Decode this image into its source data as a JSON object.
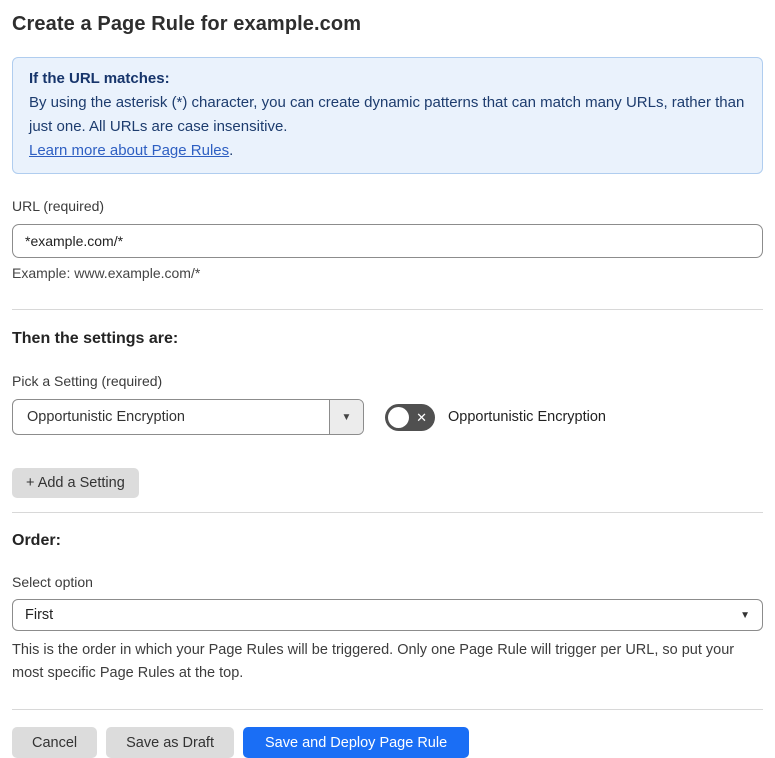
{
  "page": {
    "title": "Create a Page Rule for example.com"
  },
  "callout": {
    "heading": "If the URL matches:",
    "body": "By using the asterisk (*) character, you can create dynamic patterns that can match many URLs, rather than just one. All URLs are case insensitive.",
    "link_text": "Learn more about Page Rules",
    "link_suffix": "."
  },
  "url_field": {
    "label": "URL (required)",
    "value": "*example.com/*",
    "example": "Example: www.example.com/*"
  },
  "settings": {
    "heading": "Then the settings are:",
    "picker_label": "Pick a Setting (required)",
    "picker_value": "Opportunistic Encryption",
    "toggle_label": "Opportunistic Encryption",
    "toggle_state": "off",
    "add_button_label": "+ Add a Setting"
  },
  "order": {
    "heading": "Order:",
    "select_label": "Select option",
    "select_value": "First",
    "help": "This is the order in which your Page Rules will be triggered. Only one Page Rule will trigger per URL, so put your most specific Page Rules at the top."
  },
  "footer": {
    "cancel_label": "Cancel",
    "save_draft_label": "Save as Draft",
    "save_deploy_label": "Save and Deploy Page Rule"
  },
  "icons": {
    "caret_down": "▼",
    "toggle_off_x": "✕"
  },
  "colors": {
    "accent_blue": "#1a6ef5",
    "callout_bg": "#eaf2fc",
    "callout_border": "#b0cdef",
    "callout_text": "#1d3c6e",
    "link_blue": "#2e5fc2",
    "toggle_off_bg": "#505050",
    "gray_button_bg": "#dcdcdc",
    "input_border": "#8c8c8c",
    "divider": "#d8d8d8"
  }
}
